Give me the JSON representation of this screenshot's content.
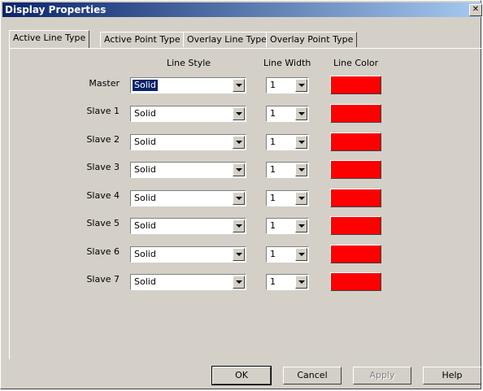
{
  "window": {
    "title": "Display Properties",
    "close_glyph": "✕"
  },
  "tabs": [
    {
      "label": "Active Line Type",
      "active": true
    },
    {
      "label": "Active Point Type",
      "active": false
    },
    {
      "label": "Overlay Line Type",
      "active": false
    },
    {
      "label": "Overlay Point Type",
      "active": false
    }
  ],
  "columns": {
    "style": "Line Style",
    "width": "Line Width",
    "color": "Line Color"
  },
  "rows": [
    {
      "label": "Master",
      "style": "Solid",
      "width": "1",
      "color": "#ff0000",
      "focused": true
    },
    {
      "label": "Slave 1",
      "style": "Solid",
      "width": "1",
      "color": "#ff0000"
    },
    {
      "label": "Slave 2",
      "style": "Solid",
      "width": "1",
      "color": "#ff0000"
    },
    {
      "label": "Slave 3",
      "style": "Solid",
      "width": "1",
      "color": "#ff0000"
    },
    {
      "label": "Slave 4",
      "style": "Solid",
      "width": "1",
      "color": "#ff0000"
    },
    {
      "label": "Slave 5",
      "style": "Solid",
      "width": "1",
      "color": "#ff0000"
    },
    {
      "label": "Slave 6",
      "style": "Solid",
      "width": "1",
      "color": "#ff0000"
    },
    {
      "label": "Slave 7",
      "style": "Solid",
      "width": "1",
      "color": "#ff0000"
    }
  ],
  "buttons": {
    "ok": "OK",
    "cancel": "Cancel",
    "apply": "Apply",
    "help": "Help"
  }
}
